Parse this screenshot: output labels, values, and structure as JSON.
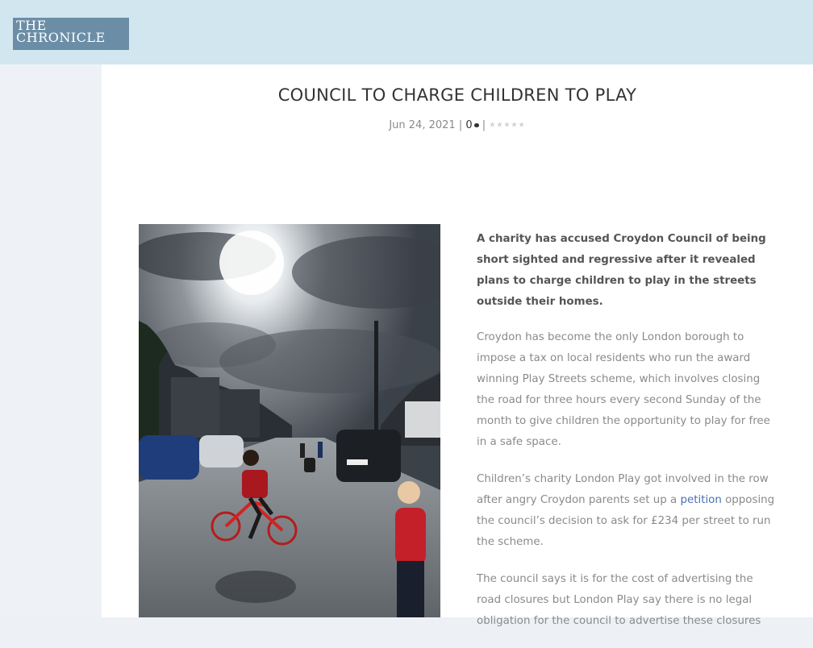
{
  "header": {
    "logo_line1": "THE",
    "logo_line2": "CHRONICLE"
  },
  "article": {
    "title": "COUNCIL TO CHARGE CHILDREN TO PLAY",
    "date": "Jun 24, 2021",
    "separator": "|",
    "comment_count": "0",
    "rating_stars": "★★★★★",
    "lead": "A charity has accused Croydon Council of being short sighted and regressive after it revealed plans to charge children to play in the streets outside their homes.",
    "paragraph1": "Croydon has become the only London borough to impose a tax on local residents who run the award winning Play Streets scheme, which involves closing the road for three hours every second Sunday of the month to give children the opportunity to play for free in a safe space.",
    "paragraph2_before": "Children’s charity London Play got involved in the row after angry Croydon parents set up a ",
    "paragraph2_link": "petition",
    "paragraph2_after": " opposing the council’s decision to ask for £234 per street to run the scheme.",
    "paragraph3": "The council says it is for the cost of advertising the road closures but London Play say there is no legal obligation for the council to advertise these closures"
  },
  "colors": {
    "topbar": "#d2e6ef",
    "logo_bg": "#6b8ea6",
    "link": "#4a6fb5",
    "title": "#333333",
    "body_text": "#8a8a8a"
  },
  "icons": {
    "comment": "comment-bubble-icon",
    "rating": "star-rating-icon"
  }
}
